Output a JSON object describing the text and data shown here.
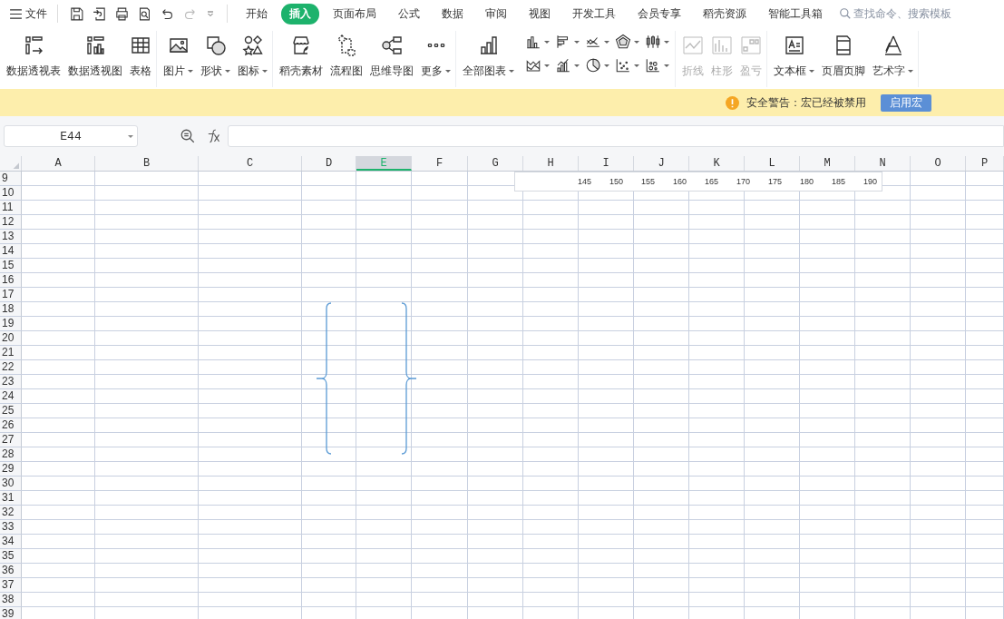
{
  "menu": {
    "label": "文件"
  },
  "tabs": [
    {
      "label": "开始",
      "selected": false
    },
    {
      "label": "插入",
      "selected": true
    },
    {
      "label": "页面布局",
      "selected": false
    },
    {
      "label": "公式",
      "selected": false
    },
    {
      "label": "数据",
      "selected": false
    },
    {
      "label": "审阅",
      "selected": false
    },
    {
      "label": "视图",
      "selected": false
    },
    {
      "label": "开发工具",
      "selected": false
    },
    {
      "label": "会员专享",
      "selected": false
    },
    {
      "label": "稻壳资源",
      "selected": false
    },
    {
      "label": "智能工具箱",
      "selected": false
    }
  ],
  "search": {
    "placeholder": "查找命令、搜索模板"
  },
  "ribbon": {
    "groups": [
      {
        "kind": "large",
        "items": [
          {
            "label": "数据透视表",
            "dropdown": false,
            "disabled": false
          },
          {
            "label": "数据透视图",
            "dropdown": false,
            "disabled": false
          },
          {
            "label": "表格",
            "dropdown": false,
            "disabled": false
          }
        ]
      },
      {
        "kind": "large",
        "items": [
          {
            "label": "图片",
            "dropdown": true,
            "disabled": false
          },
          {
            "label": "形状",
            "dropdown": true,
            "disabled": false
          },
          {
            "label": "图标",
            "dropdown": true,
            "disabled": false
          }
        ]
      },
      {
        "kind": "large",
        "items": [
          {
            "label": "稻壳素材",
            "dropdown": false,
            "disabled": false
          },
          {
            "label": "流程图",
            "dropdown": false,
            "disabled": false
          },
          {
            "label": "思维导图",
            "dropdown": false,
            "disabled": false
          },
          {
            "label": "更多",
            "dropdown": true,
            "disabled": false
          }
        ]
      },
      {
        "kind": "charts",
        "items": [
          {
            "label": "全部图表",
            "dropdown": true,
            "disabled": false
          }
        ]
      },
      {
        "kind": "large",
        "items": [
          {
            "label": "折线",
            "dropdown": false,
            "disabled": true
          },
          {
            "label": "柱形",
            "dropdown": false,
            "disabled": true
          },
          {
            "label": "盈亏",
            "dropdown": false,
            "disabled": true
          }
        ]
      },
      {
        "kind": "large",
        "items": [
          {
            "label": "文本框",
            "dropdown": true,
            "disabled": false
          },
          {
            "label": "页眉页脚",
            "dropdown": false,
            "disabled": false
          },
          {
            "label": "艺术字",
            "dropdown": true,
            "disabled": false
          }
        ]
      }
    ]
  },
  "warning": {
    "message": "安全警告：宏已经被禁用",
    "button": "启用宏"
  },
  "name_box": {
    "value": "E44"
  },
  "columns": [
    {
      "label": "A",
      "selected": false
    },
    {
      "label": "B",
      "selected": false
    },
    {
      "label": "C",
      "selected": false
    },
    {
      "label": "D",
      "selected": false
    },
    {
      "label": "E",
      "selected": true
    },
    {
      "label": "F",
      "selected": false
    },
    {
      "label": "G",
      "selected": false
    },
    {
      "label": "H",
      "selected": false
    },
    {
      "label": "I",
      "selected": false
    },
    {
      "label": "J",
      "selected": false
    },
    {
      "label": "K",
      "selected": false
    },
    {
      "label": "L",
      "selected": false
    },
    {
      "label": "M",
      "selected": false
    },
    {
      "label": "N",
      "selected": false
    },
    {
      "label": "O",
      "selected": false
    },
    {
      "label": "P",
      "selected": false
    }
  ],
  "rows": [
    "9",
    "10",
    "11",
    "12",
    "13",
    "14",
    "15",
    "16",
    "17",
    "18",
    "19",
    "20",
    "21",
    "22",
    "23",
    "24",
    "25",
    "26",
    "27",
    "28",
    "29",
    "30",
    "31",
    "32",
    "33",
    "34",
    "35",
    "36",
    "37",
    "38",
    "39"
  ],
  "text_box": {
    "values": [
      "145",
      "150",
      "155",
      "160",
      "165",
      "170",
      "175",
      "180",
      "185",
      "190"
    ]
  }
}
